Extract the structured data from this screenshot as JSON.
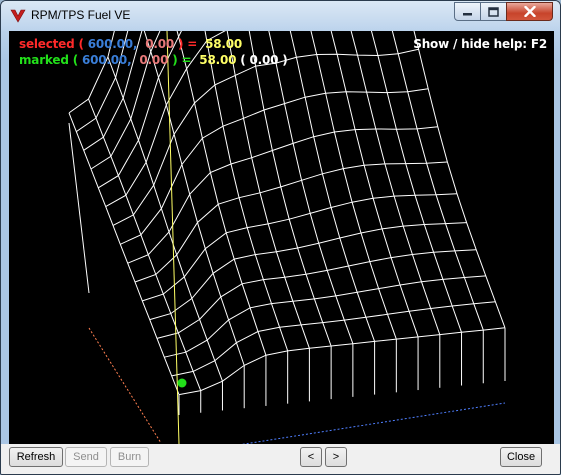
{
  "window": {
    "title": "RPM/TPS Fuel VE",
    "icon": "app-v-logo-icon",
    "controls": [
      "minimize-icon",
      "maximize-icon",
      "close-icon"
    ]
  },
  "hud": {
    "selected": {
      "label": "selected",
      "open": " (",
      "x": "600.00,",
      "y": "0.00",
      "close": ") =",
      "value": "58.00"
    },
    "marked": {
      "label": "marked",
      "open": " (",
      "x": "600.00,",
      "y": "0.00",
      "close": ") =",
      "value": "58.00",
      "extra": "( 0.00 )"
    },
    "help": "Show / hide help: F2"
  },
  "colors": {
    "selected": "#ff2a2a",
    "marked": "#22e01a",
    "x_value": "#3a7ed8",
    "y_value": "#e87a7a",
    "result": "#ffff66",
    "mesh": "#ffffff",
    "cursor_line": "#ffff66",
    "axis_rpm": "#ff7f50",
    "axis_tps": "#4f7fff",
    "marker": "#22e01a"
  },
  "buttons": {
    "refresh": "Refresh",
    "send": "Send",
    "burn": "Burn",
    "prev": "<",
    "next": ">",
    "close": "Close"
  }
}
